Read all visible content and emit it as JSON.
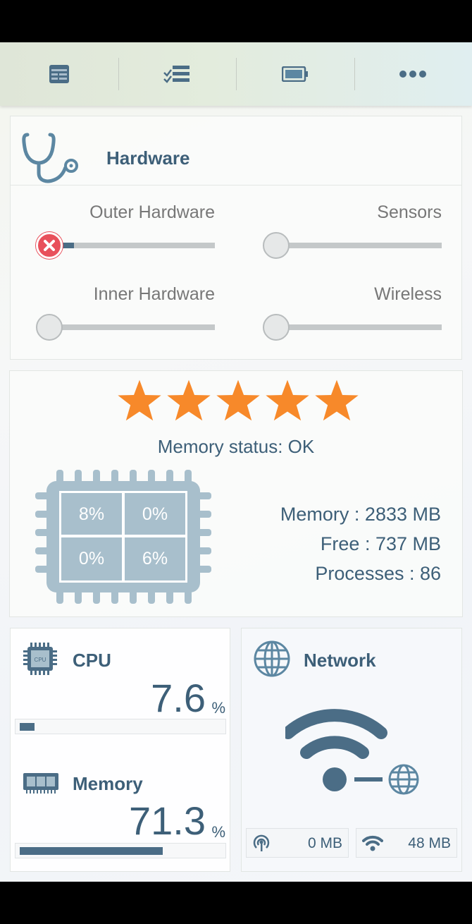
{
  "topbar": {
    "tabs": [
      {
        "icon": "table-icon"
      },
      {
        "icon": "checklist-icon"
      },
      {
        "icon": "battery-icon"
      },
      {
        "icon": "more-dots-icon"
      }
    ]
  },
  "hardware": {
    "title": "Hardware",
    "icon": "stethoscope-icon",
    "sliders": [
      {
        "label": "Outer Hardware",
        "state": "error",
        "level": 0.2
      },
      {
        "label": "Sensors",
        "state": "idle",
        "level": 0
      },
      {
        "label": "Inner Hardware",
        "state": "idle",
        "level": 0
      },
      {
        "label": "Wireless",
        "state": "idle",
        "level": 0
      }
    ]
  },
  "memory_panel": {
    "rating": 5,
    "rating_max": 5,
    "status": "Memory status: OK",
    "cores": [
      "8%",
      "0%",
      "0%",
      "6%"
    ],
    "memory_line": "Memory : 2833 MB",
    "free_line": "Free : 737 MB",
    "processes_line": "Processes : 86"
  },
  "cpu": {
    "title": "CPU",
    "value": "7.6",
    "unit": "%",
    "level": 0.076
  },
  "memory": {
    "title": "Memory",
    "value": "71.3",
    "unit": "%",
    "level": 0.713
  },
  "network": {
    "title": "Network",
    "mobile_value": "0 MB",
    "wifi_value": "48 MB"
  },
  "colors": {
    "accent": "#3d5f78",
    "bar": "#4b6d86",
    "star": "#f7892a",
    "error": "#e8505b",
    "icon": "#5c87a2"
  }
}
